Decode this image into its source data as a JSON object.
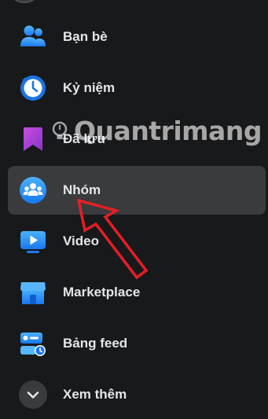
{
  "menu": {
    "items": [
      {
        "id": "friends",
        "label": "Bạn bè",
        "icon": "friends-icon"
      },
      {
        "id": "memories",
        "label": "Kỷ niệm",
        "icon": "memories-clock-icon"
      },
      {
        "id": "saved",
        "label": "Đã lưu",
        "icon": "bookmark-icon"
      },
      {
        "id": "groups",
        "label": "Nhóm",
        "icon": "groups-icon",
        "active": true
      },
      {
        "id": "video",
        "label": "Video",
        "icon": "video-play-icon"
      },
      {
        "id": "marketplace",
        "label": "Marketplace",
        "icon": "marketplace-store-icon"
      },
      {
        "id": "feeds",
        "label": "Bảng feed",
        "icon": "feeds-icon"
      },
      {
        "id": "see-more",
        "label": "Xem thêm",
        "icon": "chevron-down-icon"
      }
    ]
  },
  "watermark": {
    "text": "Quantrimang"
  },
  "colors": {
    "background": "#18191a",
    "active_row": "#3a3b3c",
    "text": "#e4e6eb",
    "accent_blue": "#1b74e4",
    "arrow_red": "#e41e26"
  }
}
